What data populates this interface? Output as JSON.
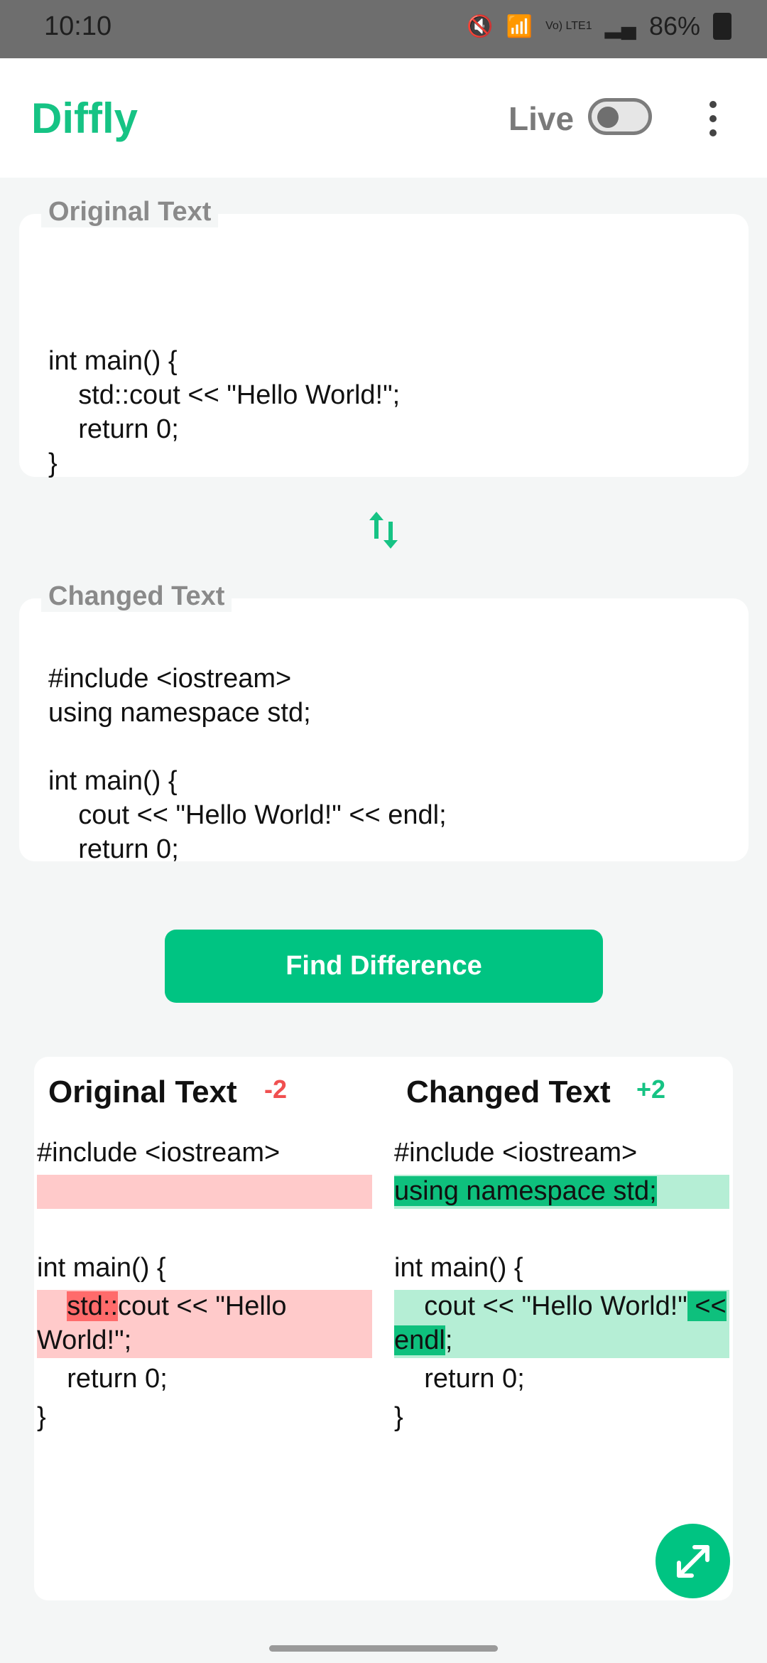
{
  "status": {
    "time": "10:10",
    "battery": "86%",
    "network": "Vo) LTE1"
  },
  "app": {
    "title": "Diffly",
    "live_label": "Live",
    "live_on": false
  },
  "original": {
    "label": "Original Text",
    "lines": [
      "int main() {",
      "    std::cout << \"Hello World!\";",
      "    return 0;",
      "}"
    ]
  },
  "changed": {
    "label": "Changed Text",
    "lines": [
      "#include <iostream>",
      "using namespace std;",
      "",
      "int main() {",
      "    cout << \"Hello World!\" << endl;",
      "    return 0;"
    ]
  },
  "action": {
    "find_label": "Find Difference"
  },
  "result": {
    "left_title": "Original Text",
    "left_count": "-2",
    "right_title": "Changed Text",
    "right_count": "+2",
    "left": {
      "line1": "#include <iostream>",
      "line4": "int main() {",
      "line5_pre": "    ",
      "line5_mark": "std::",
      "line5_post": "cout << \"Hello",
      "line6": "World!\";",
      "line7": "    return 0;",
      "line8": "}"
    },
    "right": {
      "line1": "#include <iostream>",
      "line2_mark": "using namespace std;",
      "line4": "int main() {",
      "line5_pre": "    cout << \"Hello World!\"",
      "line5_mark": " <<",
      "line6_mark": "endl",
      "line6_post": ";",
      "line7": "    return 0;",
      "line8": "}"
    }
  },
  "colors": {
    "accent": "#00c482",
    "removed": "#ffcaca",
    "added": "#b5eed5"
  }
}
